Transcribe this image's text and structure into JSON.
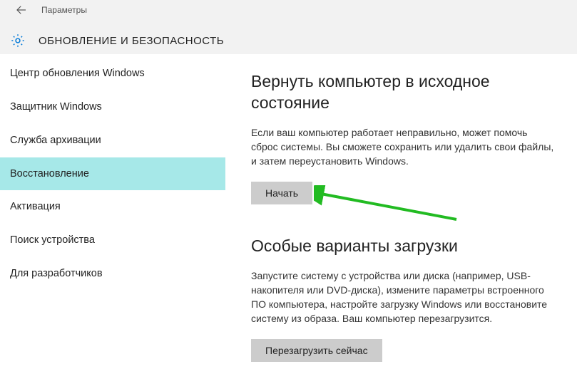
{
  "header": {
    "app_title": "Параметры",
    "category_title": "ОБНОВЛЕНИЕ И БЕЗОПАСНОСТЬ"
  },
  "sidebar": {
    "items": [
      {
        "label": "Центр обновления Windows",
        "selected": false
      },
      {
        "label": "Защитник Windows",
        "selected": false
      },
      {
        "label": "Служба архивации",
        "selected": false
      },
      {
        "label": "Восстановление",
        "selected": true
      },
      {
        "label": "Активация",
        "selected": false
      },
      {
        "label": "Поиск устройства",
        "selected": false
      },
      {
        "label": "Для разработчиков",
        "selected": false
      }
    ]
  },
  "main": {
    "reset": {
      "title": "Вернуть компьютер в исходное состояние",
      "desc": "Если ваш компьютер работает неправильно, может помочь сброс системы. Вы сможете сохранить или удалить свои файлы, и затем переустановить Windows.",
      "button": "Начать"
    },
    "advanced": {
      "title": "Особые варианты загрузки",
      "desc": "Запустите систему с устройства или диска (например, USB-накопителя или DVD-диска), измените параметры встроенного ПО компьютера, настройте загрузку Windows или восстановите систему из образа. Ваш компьютер перезагрузится.",
      "button": "Перезагрузить сейчас"
    }
  }
}
